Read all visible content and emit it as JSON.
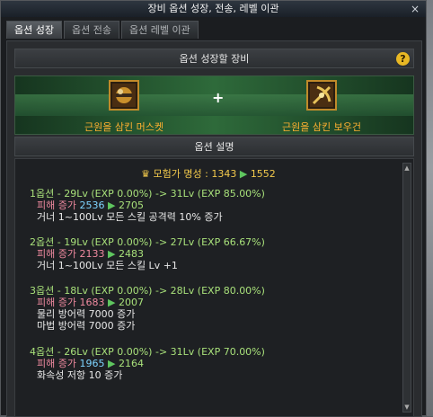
{
  "window": {
    "title": "장비 옵션 성장, 전송, 레벨 이관"
  },
  "tabs": [
    {
      "label": "옵션 성장"
    },
    {
      "label": "옵션 전송"
    },
    {
      "label": "옵션 레벨 이관"
    }
  ],
  "equip_section": {
    "title": "옵션 성장할 장비",
    "help_label": "?",
    "plus": "+",
    "left_item": {
      "name": "근원을 삼킨 머스켓",
      "icon": "musket-icon"
    },
    "right_item": {
      "name": "근원을 삼킨 보우건",
      "icon": "bowgun-icon"
    }
  },
  "desc_section": {
    "title": "옵션 설명",
    "fame": {
      "label": "모험가 명성 : 1343",
      "arrow": "▶",
      "to": "1552"
    },
    "options": [
      {
        "header": "1옵션 - 29Lv (EXP 0.00%) -> 31Lv (EXP 85.00%)",
        "dmg_label": "피해 증가",
        "dmg_from": "2536",
        "arrow": "▶",
        "dmg_to": "2705",
        "lines": [
          "거너 1~100Lv 모든 스킬 공격력 10% 증가"
        ]
      },
      {
        "header": "2옵션 - 19Lv (EXP 0.00%) -> 27Lv (EXP 66.67%)",
        "dmg_label": "피해 증가",
        "dmg_from": "2133",
        "arrow": "▶",
        "dmg_to": "2483",
        "lines": [
          "거너 1~100Lv 모든 스킬 Lv +1"
        ]
      },
      {
        "header": "3옵션 - 18Lv (EXP 0.00%) -> 28Lv (EXP 80.00%)",
        "dmg_label": "피해 증가",
        "dmg_from": "1683",
        "arrow": "▶",
        "dmg_to": "2007",
        "lines": [
          "물리 방어력 7000 증가",
          "마법 방어력 7000 증가"
        ]
      },
      {
        "header": "4옵션 - 26Lv (EXP 0.00%) -> 31Lv (EXP 70.00%)",
        "dmg_label": "피해 증가",
        "dmg_from": "1965",
        "arrow": "▶",
        "dmg_to": "2164",
        "lines": [
          "화속성 저항 10 증가"
        ]
      }
    ]
  },
  "close_label": "×",
  "colors": {
    "accent_gold": "#f2c94c",
    "green": "#a8e07a",
    "pink": "#f08aa0",
    "cyan": "#7ed4ff"
  }
}
